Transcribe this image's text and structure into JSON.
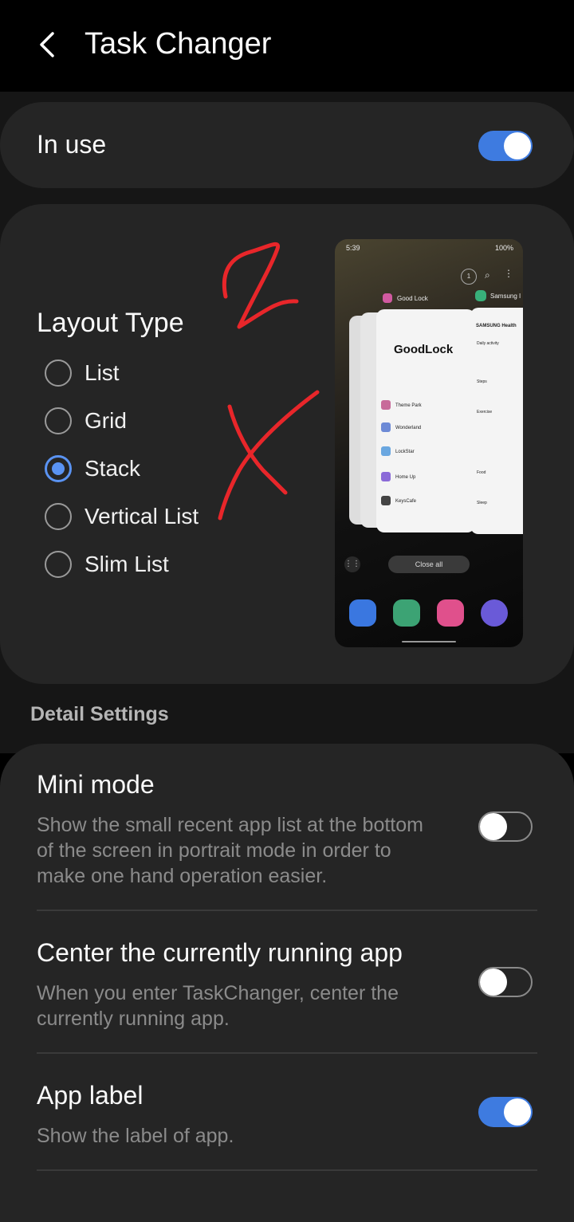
{
  "header": {
    "title": "Task Changer"
  },
  "in_use": {
    "label": "In use",
    "enabled": true
  },
  "layout": {
    "title": "Layout Type",
    "options": [
      "List",
      "Grid",
      "Stack",
      "Vertical List",
      "Slim List"
    ],
    "selected": "Stack"
  },
  "preview": {
    "status_time": "5:39",
    "status_battery": "100%",
    "app_goodlock": "Good Lock",
    "app_health": "Samsung I",
    "goodlock_logo": "GoodLock",
    "health_header": "SAMSUNG Health",
    "health_items": [
      "Daily activity",
      "Steps",
      "Exercise",
      "Food",
      "Sleep"
    ],
    "list_items": [
      "Theme Park",
      "Wonderland",
      "LockStar",
      "Home Up",
      "KeysCafe"
    ],
    "close_all": "Close all"
  },
  "detail": {
    "heading": "Detail Settings",
    "mini_mode": {
      "title": "Mini mode",
      "desc": "Show the small recent app list at the bottom of the screen in portrait mode in order to make one hand operation easier.",
      "enabled": false
    },
    "center_app": {
      "title": "Center the currently running app",
      "desc": "When you enter TaskChanger, center the currently running app.",
      "enabled": false
    },
    "app_label": {
      "title": "App label",
      "desc": "Show the label of app.",
      "enabled": true
    }
  },
  "colors": {
    "accent": "#3e7be0",
    "scribble": "#e8262a",
    "surface": "#252525"
  }
}
